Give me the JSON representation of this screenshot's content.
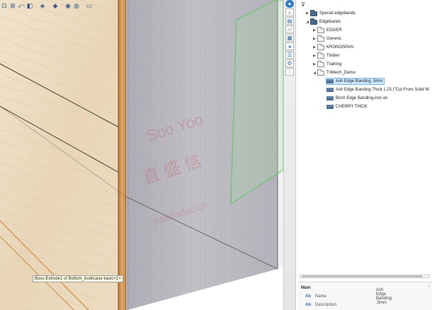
{
  "viewport": {
    "tooltip": "Boss-Extrude1 of Bottom_bookcase basic<1>",
    "watermark": [
      "Soo Yoo",
      "直 盛 信",
      "sweifsdsc.cn"
    ]
  },
  "toolbar_icons": [
    "zoom-to-fit-icon",
    "zoom-area-icon",
    "previous-view-icon",
    "section-view-icon",
    "view-orientation-icon",
    "display-style-icon",
    "hide-show-icon",
    "edit-appearance-icon",
    "apply-scene-icon",
    "view-settings-icon"
  ],
  "strip_icons": [
    "globe-icon",
    "home-icon",
    "document-library-icon",
    "file-explorer-icon",
    "view-palette-icon",
    "appearances-icon",
    "custom-properties-icon",
    "trimech-tools-icon"
  ],
  "tree": {
    "items": [
      {
        "label": "Special edgebands",
        "level": 1,
        "expanded": false,
        "kind": "folder-dark"
      },
      {
        "label": "Edgebands",
        "level": 1,
        "expanded": true,
        "kind": "folder-dark"
      },
      {
        "label": "EGGER",
        "level": 2,
        "expanded": false,
        "kind": "folder"
      },
      {
        "label": "Generic",
        "level": 2,
        "expanded": false,
        "kind": "folder"
      },
      {
        "label": "KRONOSPAN",
        "level": 2,
        "expanded": false,
        "kind": "folder"
      },
      {
        "label": "Timber",
        "level": 2,
        "expanded": false,
        "kind": "folder"
      },
      {
        "label": "Training",
        "level": 2,
        "expanded": false,
        "kind": "folder"
      },
      {
        "label": "TriMech_Demo",
        "level": 2,
        "expanded": true,
        "kind": "folder"
      },
      {
        "label": "Ash Edge Banding .5mm",
        "level": 3,
        "selected": true,
        "kind": "material"
      },
      {
        "label": "Ash Edge Banding Thick 1.25 (\"Cut From Solid W",
        "level": 3,
        "kind": "material"
      },
      {
        "label": "Birch Edge Banding-iron on",
        "level": 3,
        "kind": "material"
      },
      {
        "label": "CHERRY THICK",
        "level": 3,
        "kind": "material"
      }
    ]
  },
  "properties": {
    "section": "Main",
    "rows": [
      {
        "icon": "Ab",
        "name": "Name",
        "value": "Ash Edge Banding .5mm"
      },
      {
        "icon": "Ab",
        "name": "Description",
        "value": ""
      }
    ]
  },
  "colors": {
    "wood": "#ecdcc2",
    "panel_gray": "#b8b6bd",
    "edge_orange": "#c98a45",
    "selection_green": "#5ec65e"
  }
}
